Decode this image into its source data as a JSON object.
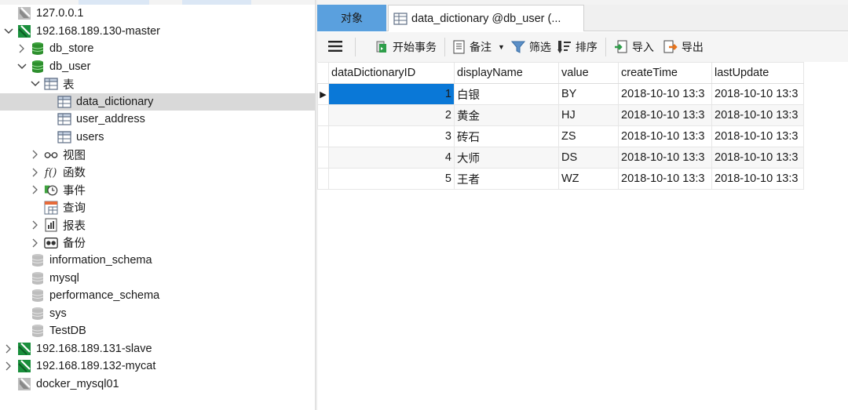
{
  "tree": {
    "nodes": [
      {
        "id": "conn-127",
        "label": "127.0.0.1",
        "level": 0,
        "chevron": "",
        "icon": "connection-gray"
      },
      {
        "id": "conn-130",
        "label": "192.168.189.130-master",
        "level": 0,
        "chevron": "down",
        "icon": "connection-green"
      },
      {
        "id": "db-store",
        "label": "db_store",
        "level": 1,
        "chevron": "right",
        "icon": "database-green"
      },
      {
        "id": "db-user",
        "label": "db_user",
        "level": 1,
        "chevron": "down",
        "icon": "database-green"
      },
      {
        "id": "tables-folder",
        "label": "表",
        "level": 2,
        "chevron": "down",
        "icon": "table"
      },
      {
        "id": "tbl-data-dictionary",
        "label": "data_dictionary",
        "level": 3,
        "chevron": "",
        "icon": "table",
        "selected": true
      },
      {
        "id": "tbl-user-address",
        "label": "user_address",
        "level": 3,
        "chevron": "",
        "icon": "table"
      },
      {
        "id": "tbl-users",
        "label": "users",
        "level": 3,
        "chevron": "",
        "icon": "table"
      },
      {
        "id": "views",
        "label": "视图",
        "level": 2,
        "chevron": "right",
        "icon": "glasses"
      },
      {
        "id": "functions",
        "label": "函数",
        "level": 2,
        "chevron": "right",
        "icon": "function"
      },
      {
        "id": "events",
        "label": "事件",
        "level": 2,
        "chevron": "right",
        "icon": "clock"
      },
      {
        "id": "queries",
        "label": "查询",
        "level": 2,
        "chevron": "",
        "icon": "query"
      },
      {
        "id": "reports",
        "label": "报表",
        "level": 2,
        "chevron": "right",
        "icon": "report"
      },
      {
        "id": "backups",
        "label": "备份",
        "level": 2,
        "chevron": "right",
        "icon": "backup"
      },
      {
        "id": "db-info-schema",
        "label": "information_schema",
        "level": 1,
        "chevron": "",
        "icon": "database-gray"
      },
      {
        "id": "db-mysql",
        "label": "mysql",
        "level": 1,
        "chevron": "",
        "icon": "database-gray"
      },
      {
        "id": "db-perf-schema",
        "label": "performance_schema",
        "level": 1,
        "chevron": "",
        "icon": "database-gray"
      },
      {
        "id": "db-sys",
        "label": "sys",
        "level": 1,
        "chevron": "",
        "icon": "database-gray"
      },
      {
        "id": "db-testdb",
        "label": "TestDB",
        "level": 1,
        "chevron": "",
        "icon": "database-gray"
      },
      {
        "id": "conn-131",
        "label": "192.168.189.131-slave",
        "level": 0,
        "chevron": "right",
        "icon": "connection-green"
      },
      {
        "id": "conn-132",
        "label": "192.168.189.132-mycat",
        "level": 0,
        "chevron": "right",
        "icon": "connection-green"
      },
      {
        "id": "conn-docker",
        "label": "docker_mysql01",
        "level": 0,
        "chevron": "",
        "icon": "connection-gray"
      }
    ]
  },
  "tabs": {
    "objects_label": "对象",
    "active_label": "data_dictionary @db_user (..."
  },
  "toolbar": {
    "menu_icon": "hamburger-icon",
    "begin_tx_label": "开始事务",
    "note_label": "备注",
    "filter_label": "筛选",
    "sort_label": "排序",
    "import_label": "导入",
    "export_label": "导出"
  },
  "grid": {
    "columns": [
      "dataDictionaryID",
      "displayName",
      "value",
      "createTime",
      "lastUpdate"
    ],
    "rows": [
      [
        "1",
        "白银",
        "BY",
        "2018-10-10 13:3",
        "2018-10-10 13:3"
      ],
      [
        "2",
        "黄金",
        "HJ",
        "2018-10-10 13:3",
        "2018-10-10 13:3"
      ],
      [
        "3",
        "砖石",
        "ZS",
        "2018-10-10 13:3",
        "2018-10-10 13:3"
      ],
      [
        "4",
        "大师",
        "DS",
        "2018-10-10 13:3",
        "2018-10-10 13:3"
      ],
      [
        "5",
        "王者",
        "WZ",
        "2018-10-10 13:3",
        "2018-10-10 13:3"
      ]
    ]
  },
  "colors": {
    "accent_tab": "#5aa0de",
    "selected_cell": "#0a78d7",
    "connection_green": "#1a8f3c"
  }
}
